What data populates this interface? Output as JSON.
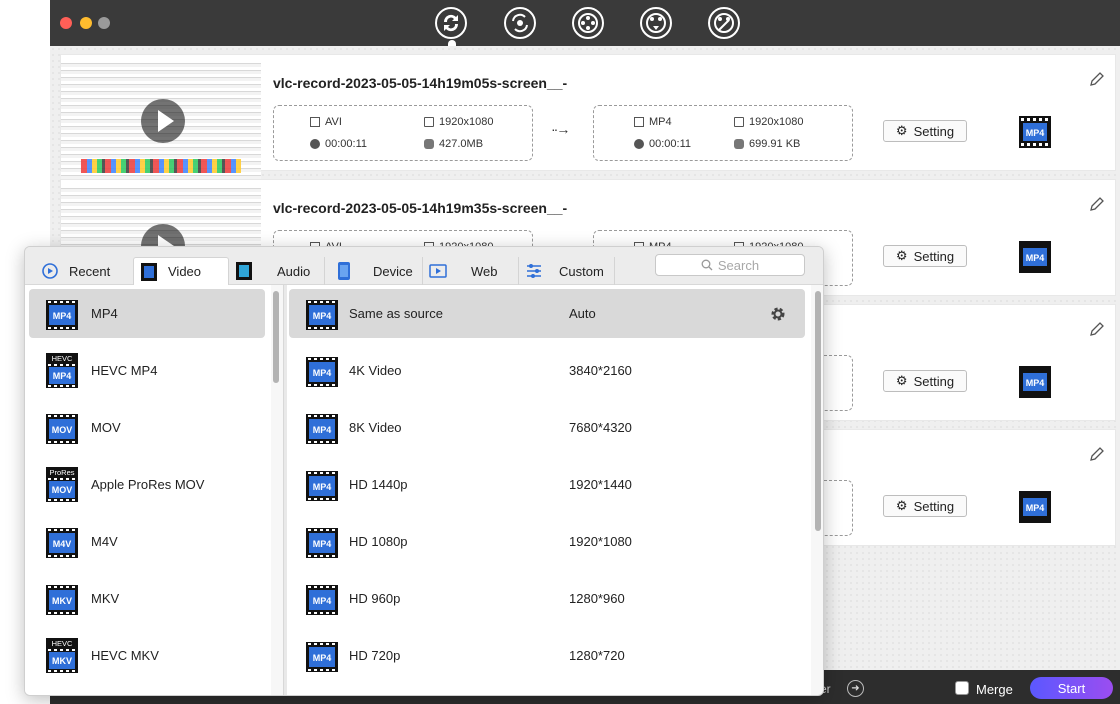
{
  "toolbar": {
    "icons": [
      "convert-icon",
      "compress-icon",
      "video-add-icon",
      "video-merge-icon",
      "video-tools-icon"
    ]
  },
  "files": [
    {
      "name": "vlc-record-2023-05-05-14h19m05s-screen__-",
      "source": {
        "format": "AVI",
        "resolution": "1920x1080",
        "duration": "00:00:11",
        "size": "427.0MB"
      },
      "target": {
        "format": "MP4",
        "resolution": "1920x1080",
        "duration": "00:00:11",
        "size": "699.91 KB"
      },
      "setting_label": "Setting",
      "badge": "MP4"
    },
    {
      "name": "vlc-record-2023-05-05-14h19m35s-screen__-",
      "source": {
        "format": "AVI",
        "resolution": "1920x1080"
      },
      "target": {
        "format": "MP4",
        "resolution": "1920x1080"
      },
      "setting_label": "Setting",
      "badge": "MP4"
    },
    {
      "setting_label": "Setting",
      "badge": "MP4"
    },
    {
      "setting_label": "Setting",
      "badge": "MP4"
    }
  ],
  "bottom": {
    "field_end": "er",
    "merge_label": "Merge",
    "start_label": "Start"
  },
  "popup": {
    "tabs": [
      {
        "label": "Recent",
        "icon": "recent-icon"
      },
      {
        "label": "Video",
        "icon": "video-film-icon",
        "active": true
      },
      {
        "label": "Audio",
        "icon": "audio-film-icon"
      },
      {
        "label": "Device",
        "icon": "phone-icon"
      },
      {
        "label": "Web",
        "icon": "web-play-icon"
      },
      {
        "label": "Custom",
        "icon": "sliders-icon"
      }
    ],
    "search_placeholder": "Search",
    "formats": [
      {
        "label": "MP4",
        "badge": "MP4",
        "top": ""
      },
      {
        "label": "HEVC MP4",
        "badge": "MP4",
        "top": "HEVC"
      },
      {
        "label": "MOV",
        "badge": "MOV",
        "top": ""
      },
      {
        "label": "Apple ProRes MOV",
        "badge": "MOV",
        "top": "ProRes"
      },
      {
        "label": "M4V",
        "badge": "M4V",
        "top": ""
      },
      {
        "label": "MKV",
        "badge": "MKV",
        "top": ""
      },
      {
        "label": "HEVC MKV",
        "badge": "MKV",
        "top": "HEVC"
      }
    ],
    "presets": [
      {
        "name": "Same as source",
        "resolution": "Auto"
      },
      {
        "name": "4K Video",
        "resolution": "3840*2160"
      },
      {
        "name": "8K Video",
        "resolution": "7680*4320"
      },
      {
        "name": "HD 1440p",
        "resolution": "1920*1440"
      },
      {
        "name": "HD 1080p",
        "resolution": "1920*1080"
      },
      {
        "name": "HD 960p",
        "resolution": "1280*960"
      },
      {
        "name": "HD 720p",
        "resolution": "1280*720"
      }
    ]
  },
  "colors": {
    "accent_start": "#5b58ff",
    "accent_end": "#9b4df0",
    "badge_blue": "#2f6fd8",
    "titlebar": "#3a3a3a"
  }
}
